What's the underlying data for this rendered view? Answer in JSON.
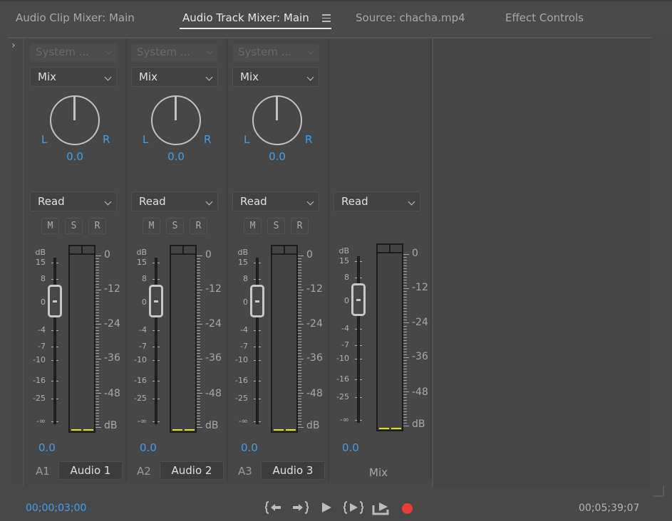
{
  "tabs": [
    {
      "label": "Audio Clip Mixer: Main",
      "active": false
    },
    {
      "label": "Audio Track Mixer: Main",
      "active": true
    },
    {
      "label": "Source: chacha.mp4",
      "active": false
    },
    {
      "label": "Effect Controls",
      "active": false
    }
  ],
  "panel_menu_icon": "hamburger-menu-icon",
  "expander_icon": "chevron-right-icon",
  "fader_scale": [
    "dB",
    "15",
    "8",
    "0",
    "-4",
    "-7",
    "-10",
    "-16",
    "-25",
    "-∞"
  ],
  "meter_scale": [
    "0",
    "-12",
    "-24",
    "-36",
    "-48",
    "dB"
  ],
  "tracks": [
    {
      "id": "A1",
      "name": "Audio 1",
      "input": "System ...",
      "send": "Mix",
      "pan_left": "L",
      "pan_right": "R",
      "pan_value": "0.0",
      "automation": "Read",
      "buttons": [
        "M",
        "S",
        "R"
      ],
      "volume": "0.0",
      "fader_db": 0
    },
    {
      "id": "A2",
      "name": "Audio 2",
      "input": "System ...",
      "send": "Mix",
      "pan_left": "L",
      "pan_right": "R",
      "pan_value": "0.0",
      "automation": "Read",
      "buttons": [
        "M",
        "S",
        "R"
      ],
      "volume": "0.0",
      "fader_db": 0
    },
    {
      "id": "A3",
      "name": "Audio 3",
      "input": "System ...",
      "send": "Mix",
      "pan_left": "L",
      "pan_right": "R",
      "pan_value": "0.0",
      "automation": "Read",
      "buttons": [
        "M",
        "S",
        "R"
      ],
      "volume": "0.0",
      "fader_db": 0
    }
  ],
  "mix": {
    "name": "Mix",
    "automation": "Read",
    "volume": "0.0",
    "fader_db": 0
  },
  "transport": {
    "current_time": "00;00;03;00",
    "duration": "00;05;39;07",
    "buttons": [
      {
        "name": "go-to-in-point",
        "icon": "go-to-in-icon"
      },
      {
        "name": "go-to-out-point",
        "icon": "go-to-out-icon"
      },
      {
        "name": "play",
        "icon": "play-icon"
      },
      {
        "name": "play-in-to-out",
        "icon": "play-in-out-icon"
      },
      {
        "name": "loop",
        "icon": "loop-icon"
      },
      {
        "name": "record",
        "icon": "record-icon"
      }
    ]
  },
  "colors": {
    "accent": "#3fa0f0",
    "record": "#ef3a3a",
    "meter_level": "#e3e31a"
  }
}
